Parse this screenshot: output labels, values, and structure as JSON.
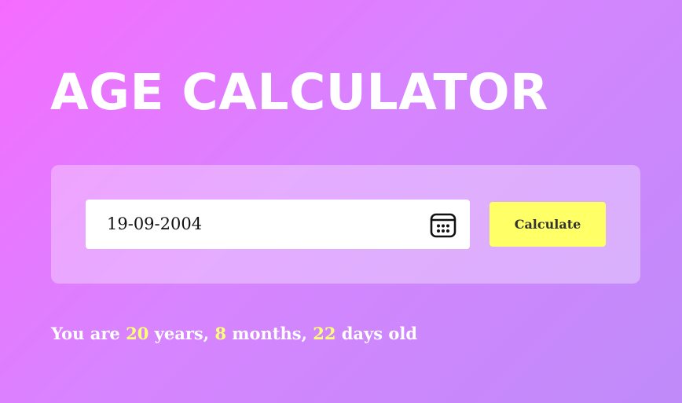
{
  "title": "AGE CALCULATOR",
  "form": {
    "date_value": "19-09-2004",
    "calculate_label": "Calculate",
    "icon": "calendar-icon"
  },
  "result": {
    "prefix": "You are ",
    "years": "20",
    "years_label": " years, ",
    "months": "8",
    "months_label": " months, ",
    "days": "22",
    "days_label": " days old"
  },
  "colors": {
    "background_start": "#f56cff",
    "background_end": "#bf8bf9",
    "button": "#ffff66",
    "highlight_numbers": "#ffff76",
    "text": "#ffffff"
  }
}
